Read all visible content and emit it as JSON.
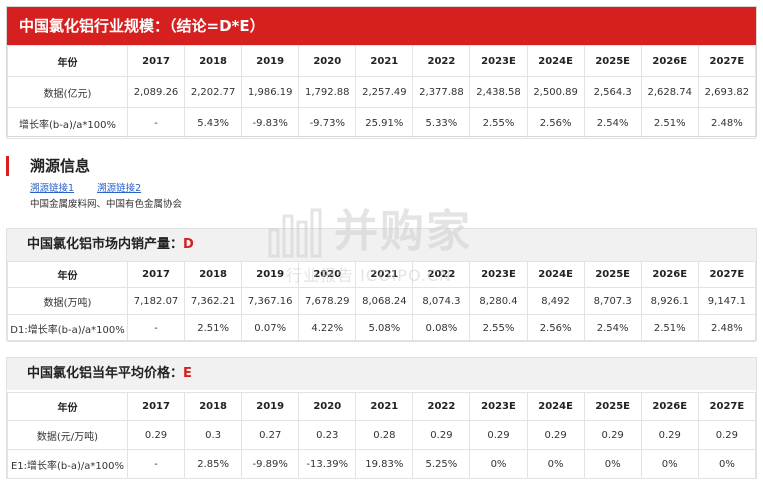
{
  "top": {
    "title": "中国氯化铝行业规模：（结论=D*E）",
    "header": [
      "年份",
      "2017",
      "2018",
      "2019",
      "2020",
      "2021",
      "2022",
      "2023E",
      "2024E",
      "2025E",
      "2026E",
      "2027E"
    ],
    "rows": [
      [
        "数据(亿元)",
        "2,089.26",
        "2,202.77",
        "1,986.19",
        "1,792.88",
        "2,257.49",
        "2,377.88",
        "2,438.58",
        "2,500.89",
        "2,564.3",
        "2,628.74",
        "2,693.82"
      ],
      [
        "增长率(b-a)/a*100%",
        "-",
        "5.43%",
        "-9.83%",
        "-9.73%",
        "25.91%",
        "5.33%",
        "2.55%",
        "2.56%",
        "2.54%",
        "2.51%",
        "2.48%"
      ]
    ]
  },
  "trace": {
    "title": "溯源信息",
    "link1": "溯源链接1",
    "link2": "溯源链接2",
    "source": "中国金属废料网、中国有色金属协会"
  },
  "section_d": {
    "title": "中国氯化铝市场内销产量：",
    "letter": "D",
    "header": [
      "年份",
      "2017",
      "2018",
      "2019",
      "2020",
      "2021",
      "2022",
      "2023E",
      "2024E",
      "2025E",
      "2026E",
      "2027E"
    ],
    "rows": [
      [
        "数据(万吨)",
        "7,182.07",
        "7,362.21",
        "7,367.16",
        "7,678.29",
        "8,068.24",
        "8,074.3",
        "8,280.4",
        "8,492",
        "8,707.3",
        "8,926.1",
        "9,147.1"
      ],
      [
        "D1:增长率(b-a)/a*100%",
        "-",
        "2.51%",
        "0.07%",
        "4.22%",
        "5.08%",
        "0.08%",
        "2.55%",
        "2.56%",
        "2.54%",
        "2.51%",
        "2.48%"
      ]
    ]
  },
  "section_e": {
    "title": "中国氯化铝当年平均价格：",
    "letter": "E",
    "header": [
      "年份",
      "2017",
      "2018",
      "2019",
      "2020",
      "2021",
      "2022",
      "2023E",
      "2024E",
      "2025E",
      "2026E",
      "2027E"
    ],
    "rows": [
      [
        "数据(元/万吨)",
        "0.29",
        "0.3",
        "0.27",
        "0.23",
        "0.28",
        "0.29",
        "0.29",
        "0.29",
        "0.29",
        "0.29",
        "0.29"
      ],
      [
        "E1:增长率(b-a)/a*100%",
        "-",
        "2.85%",
        "-9.89%",
        "-13.39%",
        "19.83%",
        "5.25%",
        "0%",
        "0%",
        "0%",
        "0%",
        "0%"
      ]
    ]
  },
  "watermark": {
    "cn": "并购家",
    "en": "行业报告 ICOIPO.CN"
  },
  "colors": {
    "accent": "#d61f1f",
    "link": "#2a62c9",
    "section_bg": "#f1f1f1"
  }
}
